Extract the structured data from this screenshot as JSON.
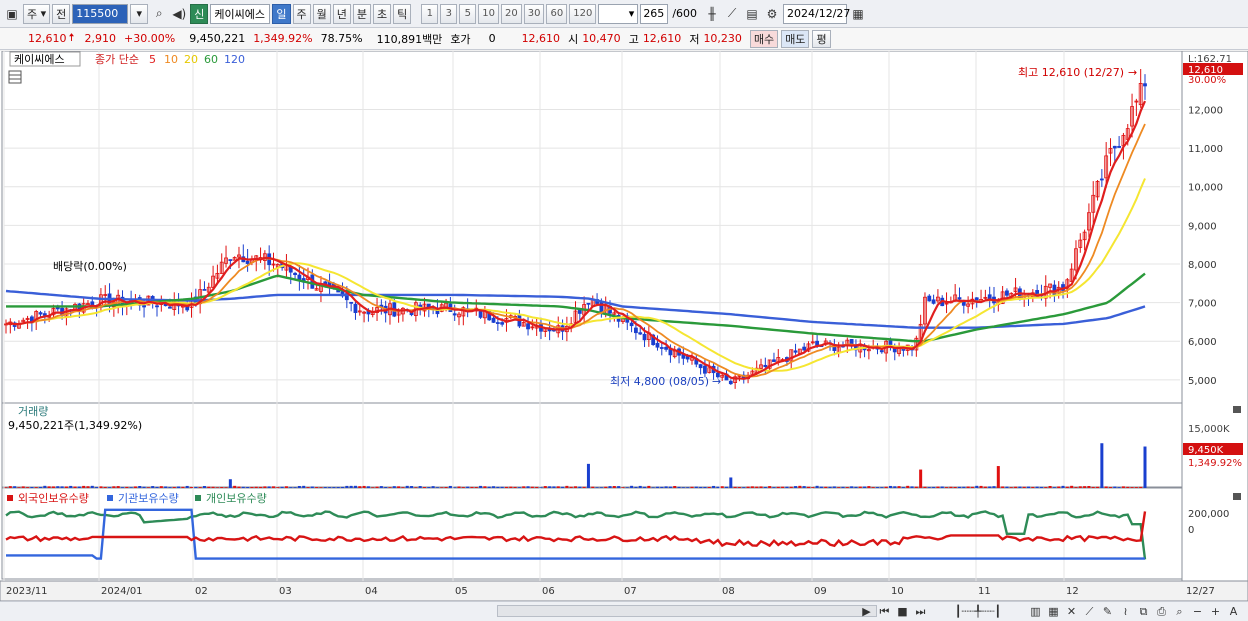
{
  "toolbar": {
    "period_type": "주",
    "prev_label": "전",
    "code": "115500",
    "new_label": "신",
    "stock_name": "케이씨에스",
    "periods": [
      "일",
      "주",
      "월",
      "년",
      "분",
      "초",
      "틱"
    ],
    "active_period": "일",
    "intervals": [
      "1",
      "3",
      "5",
      "10",
      "20",
      "30",
      "60",
      "120"
    ],
    "count": "265",
    "count_total": "/600",
    "date": "2024/12/27"
  },
  "quote": {
    "price": "12,610",
    "change": "2,910",
    "change_pct": "+30.00%",
    "volume": "9,450,221",
    "volume_pct": "1,349.92%",
    "turnover": "78.75%",
    "amount": "110,891백만",
    "hoga_label": "호가",
    "hoga_value": "0",
    "hoga_price": "12,610",
    "open_label": "시",
    "open": "10,470",
    "high_label": "고",
    "high": "12,610",
    "low_label": "저",
    "low": "10,230",
    "buy_label": "매수",
    "sell_label": "매도",
    "avg_label": "평"
  },
  "colors": {
    "ma5": "#e01e1e",
    "ma10": "#ee8a22",
    "ma20": "#f5e632",
    "ma60": "#2a9a3a",
    "ma120": "#3a5fd8",
    "up": "#e01010",
    "down": "#1a3fcf",
    "foreign": "#d81414",
    "institution": "#3366dd",
    "individual": "#2e8b57"
  },
  "chart_data": [
    {
      "type": "candlestick",
      "title": "케이씨에스",
      "legend": {
        "label": "종가 단순",
        "periods": [
          "5",
          "10",
          "20",
          "60",
          "120"
        ],
        "placement": "top-left"
      },
      "ylim": [
        4400,
        13100
      ],
      "yticks": [
        "5,000",
        "6,000",
        "7,000",
        "8,000",
        "9,000",
        "10,000",
        "11,000",
        "12,000"
      ],
      "ytick_values": [
        5000,
        6000,
        7000,
        8000,
        9000,
        10000,
        11000,
        12000
      ],
      "last_price_label": "12,610",
      "right_top_labels": [
        "L:162.71",
        "30.00%"
      ],
      "annotations": {
        "high": "최고 12,610 (12/27)",
        "low": "최저 4,800 (08/05)",
        "dividend": "배당락(0.00%)"
      },
      "keypoints": {
        "dates": [
          "2023/11 start",
          "2024/01",
          "02",
          "02 spike",
          "03",
          "04",
          "05",
          "06",
          "06 spike",
          "07",
          "08 low",
          "09",
          "10",
          "10 jump",
          "11",
          "12",
          "12 spike",
          "12/27"
        ],
        "close": [
          6450,
          7050,
          6950,
          8300,
          8000,
          6800,
          6850,
          6300,
          7150,
          6500,
          4900,
          5900,
          5850,
          7000,
          7100,
          7400,
          10700,
          12610
        ],
        "ma60": [
          6900,
          6900,
          7100,
          7300,
          7700,
          7200,
          7000,
          6900,
          6800,
          6600,
          6400,
          6200,
          6000,
          6000,
          6300,
          6700,
          7000,
          7750
        ],
        "ma120": [
          7300,
          7100,
          7050,
          7100,
          7200,
          7200,
          7200,
          7150,
          7100,
          6900,
          6700,
          6500,
          6350,
          6350,
          6350,
          6450,
          6600,
          6900
        ]
      }
    },
    {
      "type": "bar",
      "title": "거래량",
      "subtitle": "9,450,221주(1,349.92%)",
      "yticks": [
        "15,000K",
        "9,450K",
        "1,349.92%"
      ],
      "last_value": 9450221,
      "spikes": [
        {
          "date": "02",
          "value": 2000000
        },
        {
          "date": "06",
          "value": 5500000
        },
        {
          "date": "08",
          "value": 2400000
        },
        {
          "date": "10",
          "value": 4200000
        },
        {
          "date": "11",
          "value": 5000000
        },
        {
          "date": "12",
          "value": 10200000
        },
        {
          "date": "12/27",
          "value": 9450221
        }
      ]
    },
    {
      "type": "line",
      "series": [
        {
          "name": "외국인보유수량"
        },
        {
          "name": "기관보유수량"
        },
        {
          "name": "개인보유수량"
        }
      ],
      "yticks": [
        "200,000",
        "0"
      ],
      "ytick_values": [
        200000,
        0
      ]
    }
  ],
  "x_axis": {
    "labels": [
      "2023/11",
      "2024/01",
      "02",
      "03",
      "04",
      "05",
      "06",
      "07",
      "08",
      "09",
      "10",
      "11",
      "12"
    ],
    "end_label": "12/27"
  }
}
